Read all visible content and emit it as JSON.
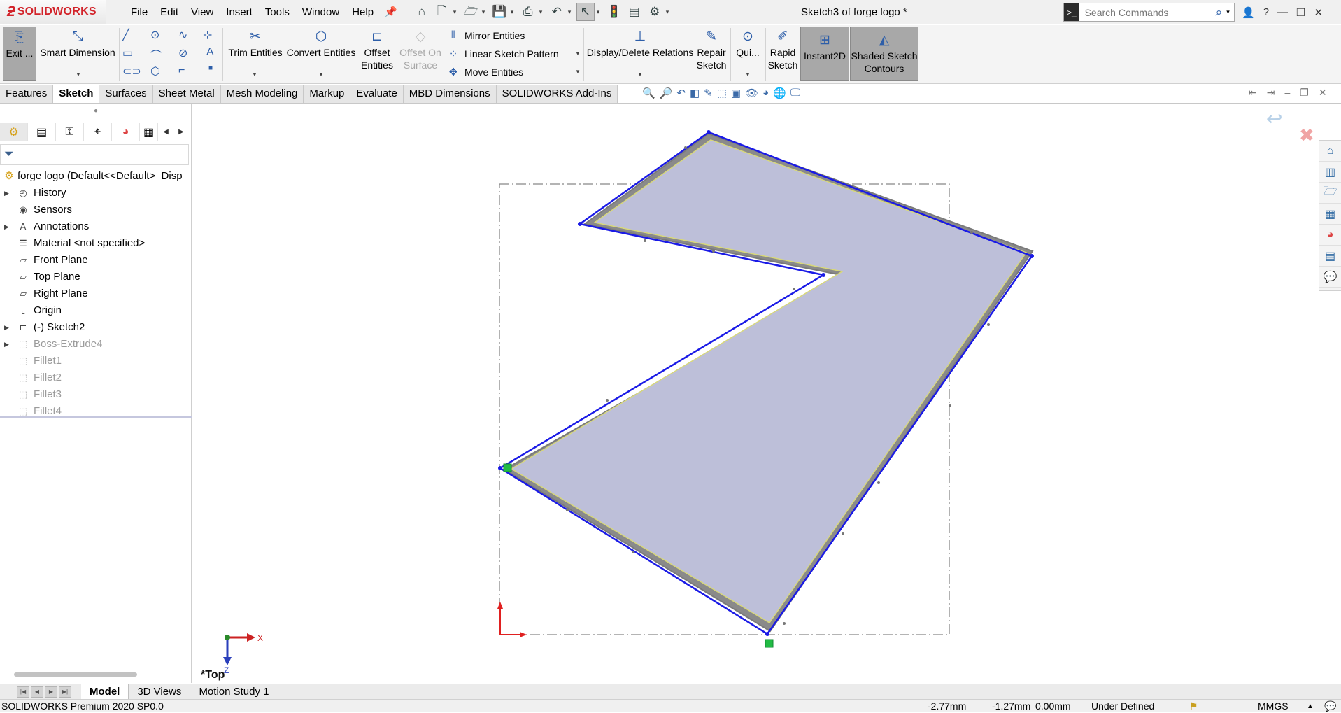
{
  "app": {
    "brand": "SOLIDWORKS",
    "document_title": "Sketch3 of forge logo *"
  },
  "menu": [
    "File",
    "Edit",
    "View",
    "Insert",
    "Tools",
    "Window",
    "Help"
  ],
  "search": {
    "placeholder": "Search Commands"
  },
  "commands": {
    "exit_sketch": "Exit ...",
    "smart_dimension": "Smart Dimension",
    "trim_entities": "Trim Entities",
    "convert_entities": "Convert Entities",
    "offset_entities": [
      "Offset",
      "Entities"
    ],
    "offset_on_surface": [
      "Offset On",
      "Surface"
    ],
    "mirror_entities": "Mirror Entities",
    "linear_sketch_pattern": "Linear Sketch Pattern",
    "move_entities": "Move Entities",
    "display_delete_relations": "Display/Delete Relations",
    "repair_sketch": [
      "Repair",
      "Sketch"
    ],
    "quick_snaps": "Qui...",
    "rapid_sketch": [
      "Rapid",
      "Sketch"
    ],
    "instant2d": "Instant2D",
    "shaded_sketch_contours": [
      "Shaded Sketch",
      "Contours"
    ]
  },
  "tabs": [
    "Features",
    "Sketch",
    "Surfaces",
    "Sheet Metal",
    "Mesh Modeling",
    "Markup",
    "Evaluate",
    "MBD Dimensions",
    "SOLIDWORKS Add-Ins"
  ],
  "active_tab": "Sketch",
  "feature_tree": {
    "root": "forge logo  (Default<<Default>_Disp",
    "nodes": [
      {
        "label": "History",
        "icon": "history-icon",
        "expandable": true,
        "suppressed": false
      },
      {
        "label": "Sensors",
        "icon": "sensors-icon",
        "expandable": false,
        "suppressed": false
      },
      {
        "label": "Annotations",
        "icon": "annotations-icon",
        "expandable": true,
        "suppressed": false
      },
      {
        "label": "Material <not specified>",
        "icon": "material-icon",
        "expandable": false,
        "suppressed": false
      },
      {
        "label": "Front Plane",
        "icon": "plane-icon",
        "expandable": false,
        "suppressed": false
      },
      {
        "label": "Top Plane",
        "icon": "plane-icon",
        "expandable": false,
        "suppressed": false
      },
      {
        "label": "Right Plane",
        "icon": "plane-icon",
        "expandable": false,
        "suppressed": false
      },
      {
        "label": "Origin",
        "icon": "origin-icon",
        "expandable": false,
        "suppressed": false
      },
      {
        "label": "(-) Sketch2",
        "icon": "sketch-icon",
        "expandable": true,
        "suppressed": false
      },
      {
        "label": "Boss-Extrude4",
        "icon": "extrude-icon",
        "expandable": true,
        "suppressed": true
      },
      {
        "label": "Fillet1",
        "icon": "fillet-icon",
        "expandable": false,
        "suppressed": true
      },
      {
        "label": "Fillet2",
        "icon": "fillet-icon",
        "expandable": false,
        "suppressed": true
      },
      {
        "label": "Fillet3",
        "icon": "fillet-icon",
        "expandable": false,
        "suppressed": true
      },
      {
        "label": "Fillet4",
        "icon": "fillet-icon",
        "expandable": false,
        "suppressed": true
      }
    ]
  },
  "graphics": {
    "view_label": "*Top",
    "triad": {
      "x": "X",
      "z": "Z"
    }
  },
  "bottom_tabs": [
    "Model",
    "3D Views",
    "Motion Study 1"
  ],
  "active_bottom_tab": "Model",
  "status": {
    "product": "SOLIDWORKS Premium 2020 SP0.0",
    "x": "-2.77mm",
    "y": "-1.27mm",
    "z": "0.00mm",
    "state": "Under Defined",
    "units": "MMGS"
  },
  "colors": {
    "brand_red": "#d2232a",
    "sketch_line": "#1a1ae6",
    "sketch_fill": "#bdbfd9",
    "sketch_shadow": "#8a8a8a",
    "origin_red": "#e02020",
    "relation_green": "#22bb44"
  }
}
